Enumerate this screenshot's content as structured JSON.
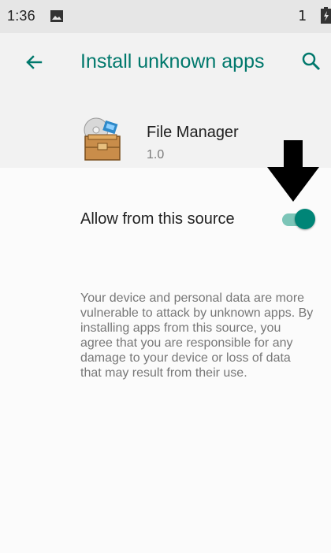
{
  "status_bar": {
    "time": "1:36",
    "sim_indicator": "1",
    "icons": [
      "photo-notification-icon",
      "battery-icon"
    ]
  },
  "app_bar": {
    "title": "Install unknown apps",
    "back_icon": "arrow-back-icon",
    "search_icon": "search-icon",
    "accent_color": "#00786c"
  },
  "app_info": {
    "name": "File Manager",
    "version": "1.0",
    "icon": "file-manager-box-icon"
  },
  "settings": {
    "allow_label": "Allow from this source",
    "allow_enabled": true,
    "toggle_color": "#008577",
    "warning": "Your device and personal data are more vulnerable to attack by unknown apps. By installing apps from this source, you agree that you are responsible for any damage to your device or loss of data that may result from their use."
  },
  "annotation": {
    "icon": "down-arrow-icon"
  }
}
